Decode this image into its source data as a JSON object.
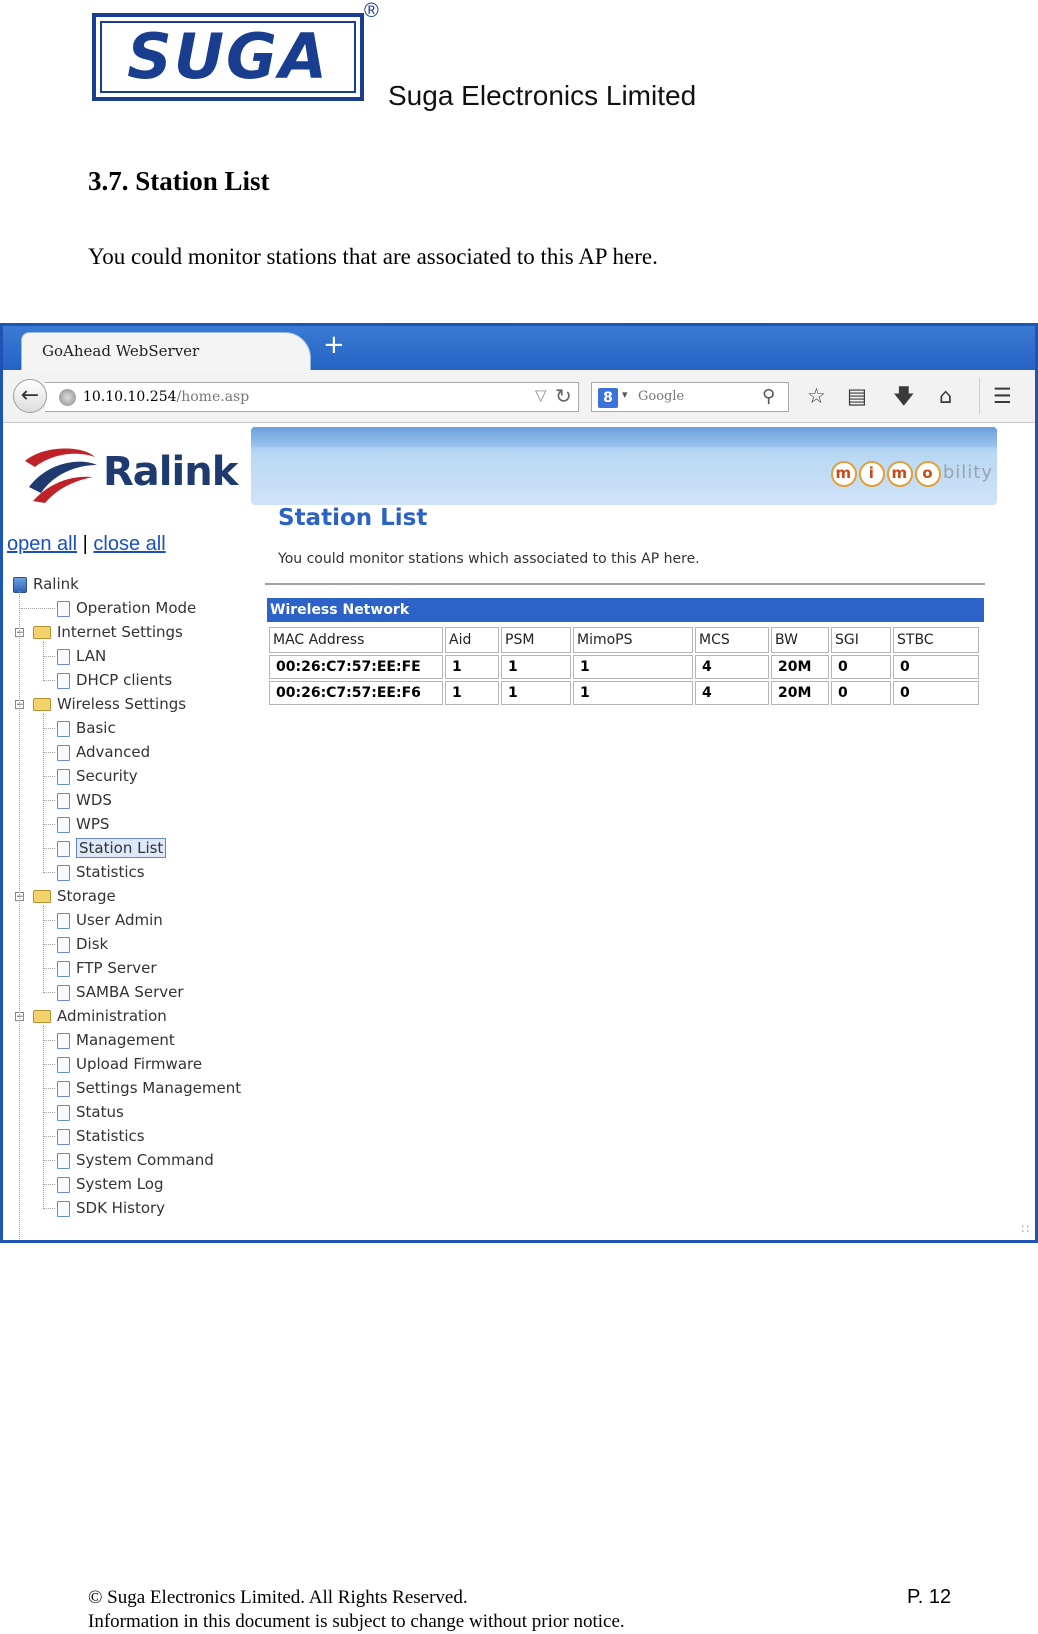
{
  "doc": {
    "logo_text": "SUGA",
    "registered_mark": "®",
    "company": "Suga Electronics Limited",
    "section_title": "3.7.  Station List",
    "intro": "You could monitor stations that are associated to this AP here.",
    "footer_copyright": "© Suga Electronics Limited. All Rights Reserved.",
    "footer_notice": "Information in this document is subject to change without prior notice.",
    "page_number": "P. 12"
  },
  "browser": {
    "tab_title": "GoAhead WebServer",
    "new_tab": "+",
    "url_host": "10.10.10.254",
    "url_path": "/home.asp",
    "search_placeholder": "Google",
    "search_engine_letter": "8",
    "icons": [
      "back-icon",
      "reload-icon",
      "bookmark-star-icon",
      "reading-list-icon",
      "download-icon",
      "home-icon",
      "menu-icon"
    ]
  },
  "brand": {
    "ralink": "Ralink",
    "mimo_letters": [
      "m",
      "i",
      "m",
      "o"
    ],
    "mimo_rest": "bility"
  },
  "nav": {
    "open_all": "open all",
    "separator": "|",
    "close_all": "close all",
    "items": [
      {
        "label": "Ralink",
        "level": 0,
        "type": "root"
      },
      {
        "label": "Operation Mode",
        "level": 1,
        "type": "page"
      },
      {
        "label": "Internet Settings",
        "level": 0,
        "type": "folder"
      },
      {
        "label": "LAN",
        "level": 1,
        "type": "page"
      },
      {
        "label": "DHCP clients",
        "level": 1,
        "type": "page"
      },
      {
        "label": "Wireless Settings",
        "level": 0,
        "type": "folder"
      },
      {
        "label": "Basic",
        "level": 1,
        "type": "page"
      },
      {
        "label": "Advanced",
        "level": 1,
        "type": "page"
      },
      {
        "label": "Security",
        "level": 1,
        "type": "page"
      },
      {
        "label": "WDS",
        "level": 1,
        "type": "page"
      },
      {
        "label": "WPS",
        "level": 1,
        "type": "page"
      },
      {
        "label": "Station List",
        "level": 1,
        "type": "page",
        "selected": true
      },
      {
        "label": "Statistics",
        "level": 1,
        "type": "page"
      },
      {
        "label": "Storage",
        "level": 0,
        "type": "folder"
      },
      {
        "label": "User Admin",
        "level": 1,
        "type": "page"
      },
      {
        "label": "Disk",
        "level": 1,
        "type": "page"
      },
      {
        "label": "FTP Server",
        "level": 1,
        "type": "page"
      },
      {
        "label": "SAMBA Server",
        "level": 1,
        "type": "page"
      },
      {
        "label": "Administration",
        "level": 0,
        "type": "folder"
      },
      {
        "label": "Management",
        "level": 1,
        "type": "page"
      },
      {
        "label": "Upload Firmware",
        "level": 1,
        "type": "page"
      },
      {
        "label": "Settings Management",
        "level": 1,
        "type": "page"
      },
      {
        "label": "Status",
        "level": 1,
        "type": "page"
      },
      {
        "label": "Statistics",
        "level": 1,
        "type": "page"
      },
      {
        "label": "System Command",
        "level": 1,
        "type": "page"
      },
      {
        "label": "System Log",
        "level": 1,
        "type": "page"
      },
      {
        "label": "SDK History",
        "level": 1,
        "type": "page"
      }
    ]
  },
  "main": {
    "title": "Station List",
    "description": "You could monitor stations which associated to this AP here.",
    "section_header": "Wireless Network",
    "columns": [
      "MAC Address",
      "Aid",
      "PSM",
      "MimoPS",
      "MCS",
      "BW",
      "SGI",
      "STBC"
    ],
    "rows": [
      [
        "00:26:C7:57:EE:FE",
        "1",
        "1",
        "1",
        "4",
        "20M",
        "0",
        "0"
      ],
      [
        "00:26:C7:57:EE:F6",
        "1",
        "1",
        "1",
        "4",
        "20M",
        "0",
        "0"
      ]
    ]
  }
}
